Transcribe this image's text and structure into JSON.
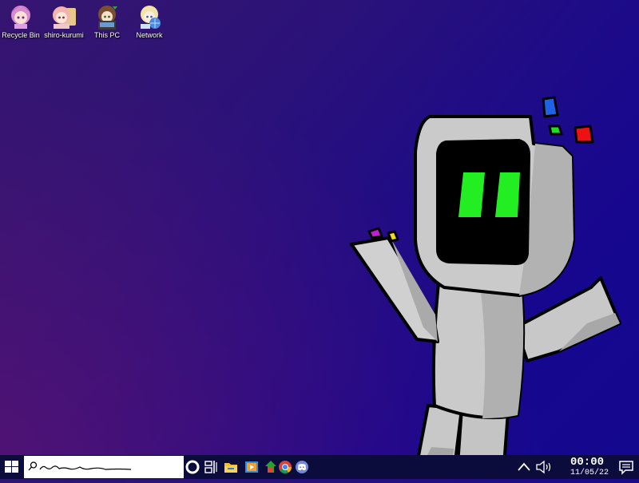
{
  "desktop": {
    "icons": [
      {
        "label": "Recycle Bin",
        "icon": "recycle-bin-icon"
      },
      {
        "label": "shiro-kurumi",
        "icon": "user-folder-icon"
      },
      {
        "label": "This PC",
        "icon": "this-pc-icon"
      },
      {
        "label": "Network",
        "icon": "network-icon"
      }
    ],
    "wallpaper_colors": {
      "top_right": "#17078f",
      "bottom_left": "#3a126e",
      "robot_body": "#c8c8c8",
      "robot_eyes": "#22ee22"
    }
  },
  "taskbar": {
    "start_icon": "windows-start-icon",
    "search": {
      "value": "",
      "placeholder": "",
      "icon": "search-icon"
    },
    "pinned": [
      {
        "icon": "cortana-icon"
      },
      {
        "icon": "task-view-icon"
      },
      {
        "icon": "file-explorer-icon"
      },
      {
        "icon": "media-player-icon"
      },
      {
        "icon": "store-icon"
      },
      {
        "icon": "chrome-icon"
      },
      {
        "icon": "discord-icon"
      }
    ],
    "tray": {
      "show_hidden_icon": "chevron-up-icon",
      "volume_icon": "volume-icon",
      "time": "00:00",
      "date": "11/05/22",
      "notifications_icon": "action-center-icon"
    },
    "background": "#0b0c3c"
  }
}
